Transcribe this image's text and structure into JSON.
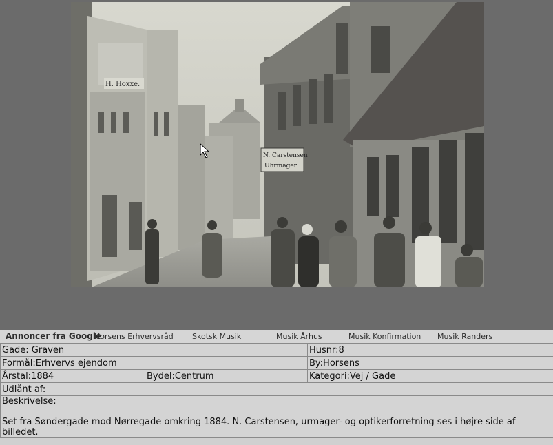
{
  "photo": {
    "sign_left": "H. Hoxxe.",
    "sign_shop_line1": "N. Carstensen",
    "sign_shop_line2": "Uhrmager"
  },
  "ads": {
    "title": "Annoncer fra Google",
    "links": [
      "Horsens Erhvervsråd",
      "Skotsk Musik",
      "Musik Århus",
      "Musik Konfirmation",
      "Musik Randers"
    ]
  },
  "record": {
    "gade": "Gade: Graven",
    "husnr": "Husnr:8",
    "formaal": "Formål:Erhvervs ejendom",
    "by": "By:Horsens",
    "aarstal": "Årstal:1884",
    "bydel": "Bydel:Centrum",
    "kategori": "Kategori:Vej / Gade",
    "udlaant": "Udlånt af:",
    "beskrivelse_label": "Beskrivelse:",
    "beskrivelse": "Set fra Søndergade mod Nørregade omkring 1884. N. Carstensen, urmager- og optikerforretning ses i højre side af billedet."
  }
}
